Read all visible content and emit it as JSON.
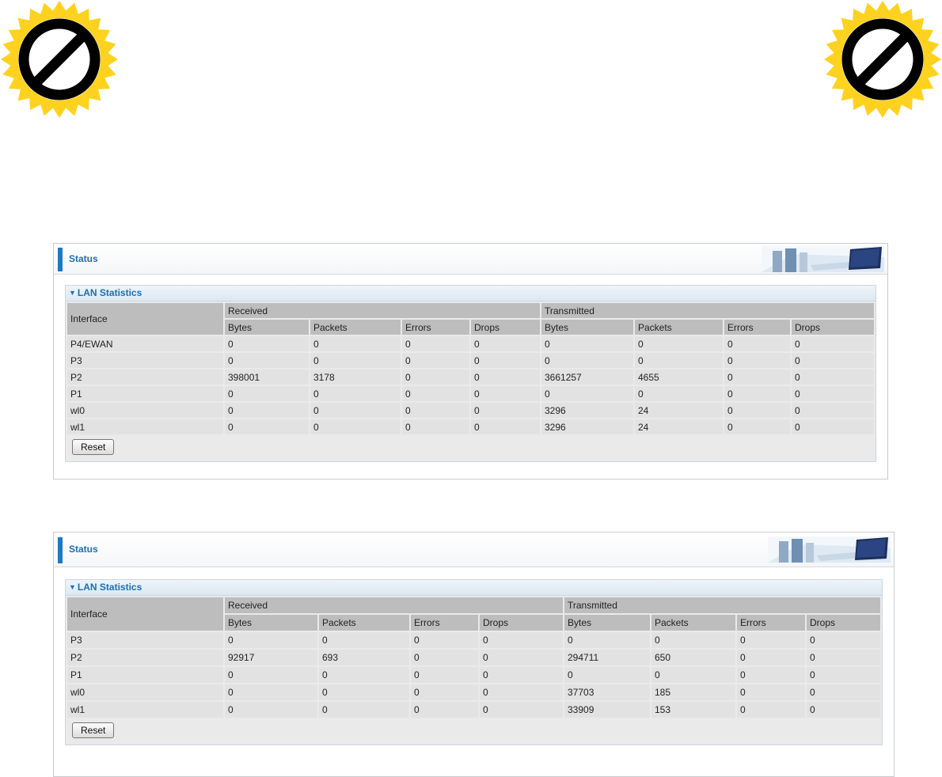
{
  "panels": [
    {
      "header_title": "Status",
      "section_title": "LAN Statistics",
      "interface_label": "Interface",
      "received_label": "Received",
      "transmitted_label": "Transmitted",
      "columns": [
        "Bytes",
        "Packets",
        "Errors",
        "Drops",
        "Bytes",
        "Packets",
        "Errors",
        "Drops"
      ],
      "rows": [
        [
          "P4/EWAN",
          "0",
          "0",
          "0",
          "0",
          "0",
          "0",
          "0",
          "0"
        ],
        [
          "P3",
          "0",
          "0",
          "0",
          "0",
          "0",
          "0",
          "0",
          "0"
        ],
        [
          "P2",
          "398001",
          "3178",
          "0",
          "0",
          "3661257",
          "4655",
          "0",
          "0"
        ],
        [
          "P1",
          "0",
          "0",
          "0",
          "0",
          "0",
          "0",
          "0",
          "0"
        ],
        [
          "wl0",
          "0",
          "0",
          "0",
          "0",
          "3296",
          "24",
          "0",
          "0"
        ],
        [
          "wl1",
          "0",
          "0",
          "0",
          "0",
          "3296",
          "24",
          "0",
          "0"
        ]
      ],
      "reset_label": "Reset"
    },
    {
      "header_title": "Status",
      "section_title": "LAN Statistics",
      "interface_label": "Interface",
      "received_label": "Received",
      "transmitted_label": "Transmitted",
      "columns": [
        "Bytes",
        "Packets",
        "Errors",
        "Drops",
        "Bytes",
        "Packets",
        "Errors",
        "Drops"
      ],
      "rows": [
        [
          "P3",
          "0",
          "0",
          "0",
          "0",
          "0",
          "0",
          "0",
          "0"
        ],
        [
          "P2",
          "92917",
          "693",
          "0",
          "0",
          "294711",
          "650",
          "0",
          "0"
        ],
        [
          "P1",
          "0",
          "0",
          "0",
          "0",
          "0",
          "0",
          "0",
          "0"
        ],
        [
          "wl0",
          "0",
          "0",
          "0",
          "0",
          "37703",
          "185",
          "0",
          "0"
        ],
        [
          "wl1",
          "0",
          "0",
          "0",
          "0",
          "33909",
          "153",
          "0",
          "0"
        ]
      ],
      "reset_label": "Reset"
    }
  ],
  "badge_icon": "prohibited-icon",
  "colors": {
    "badge_yellow": "#ffd21f",
    "accent_blue": "#1b7ac6",
    "header_gray": "#bdbdbd",
    "row_gray": "#e2e2e2"
  }
}
